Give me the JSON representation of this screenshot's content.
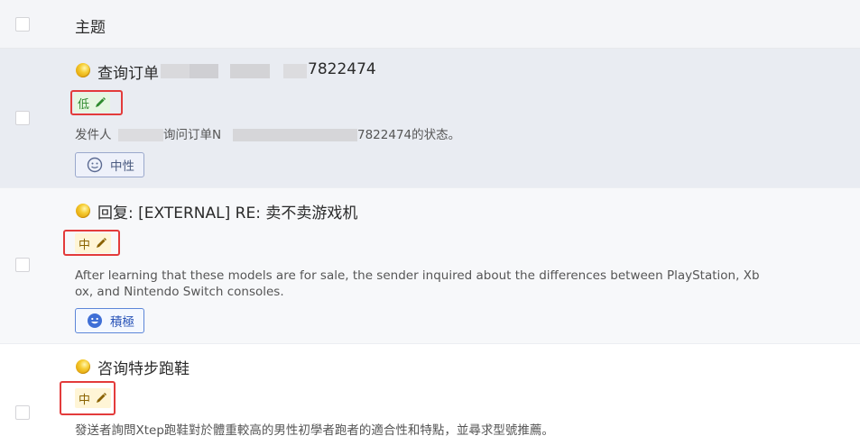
{
  "header": {
    "subject_label": "主题"
  },
  "tickets": [
    {
      "subject_prefix": "查询订单",
      "subject_suffix": "7822474",
      "priority": "低",
      "summary_prefix": "发件人",
      "summary_mid": "询问订单N",
      "summary_suffix": "7822474的状态。",
      "sentiment": "中性",
      "sentiment_icon": "neutral-face-icon"
    },
    {
      "subject": "回复: [EXTERNAL] RE: 卖不卖游戏机",
      "priority": "中",
      "summary_line1": "After learning that these models are for sale, the sender inquired about the differences between PlayStation, Xb",
      "summary_line2": "ox, and Nintendo Switch consoles.",
      "sentiment": "積極",
      "sentiment_icon": "happy-face-icon"
    },
    {
      "subject": "咨询特步跑鞋",
      "priority": "中",
      "summary": "發送者詢問Xtep跑鞋對於體重較高的男性初學者跑者的適合性和特點，並尋求型號推薦。"
    }
  ],
  "colors": {
    "highlight_border": "#e33b3b",
    "priority_low": "#2f8a2f",
    "priority_mid": "#8a6200",
    "sentiment_positive": "#2a55b8"
  }
}
